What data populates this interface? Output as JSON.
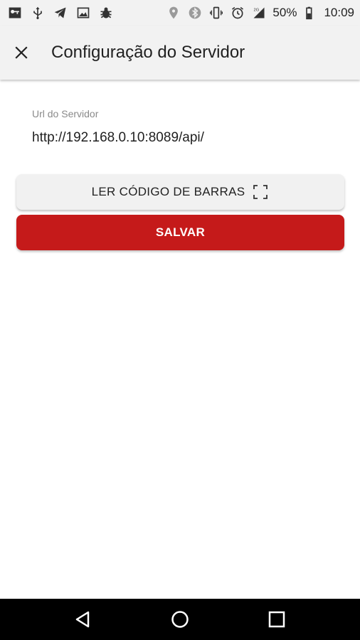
{
  "status_bar": {
    "battery_percent": "50%",
    "time": "10:09",
    "network_label": "2G",
    "left_icons": [
      "vpn-key-icon",
      "usb-icon",
      "telegram-icon",
      "image-icon",
      "bug-icon"
    ],
    "right_icons": [
      "location-icon",
      "bluetooth-icon",
      "vibrate-icon",
      "alarm-icon",
      "signal-icon",
      "battery-icon"
    ]
  },
  "app_bar": {
    "title": "Configuração do Servidor",
    "close_icon": "close-icon"
  },
  "form": {
    "url_label": "Url do Servidor",
    "url_value": "http://192.168.0.10:8089/api/"
  },
  "buttons": {
    "scan_label": "LER CÓDIGO DE BARRAS",
    "scan_icon": "barcode-scan-frame-icon",
    "save_label": "SALVAR"
  },
  "nav_bar": {
    "back_icon": "back-triangle-icon",
    "home_icon": "home-circle-icon",
    "recents_icon": "recents-square-icon"
  },
  "colors": {
    "accent": "#c51a1a",
    "status_bar_bg": "#f2f2f2",
    "nav_bar_bg": "#000000"
  }
}
